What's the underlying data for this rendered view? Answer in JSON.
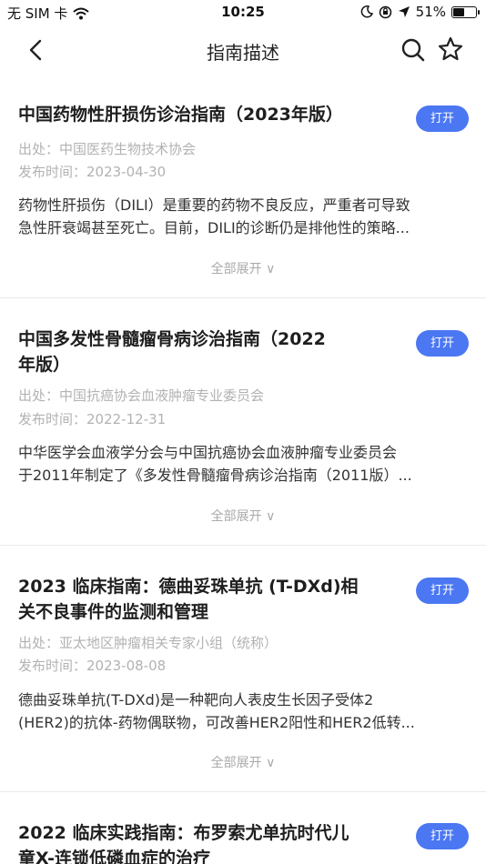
{
  "status_bar": {
    "carrier": "无 SIM 卡",
    "time": "10:25",
    "battery_percent": "51%",
    "battery_level": 0.51
  },
  "nav": {
    "title": "指南描述",
    "back_icon": "chevron-left-icon",
    "search_icon": "search-icon",
    "favorite_icon": "star-icon"
  },
  "accent_color": "#4b77f2",
  "guides": [
    {
      "title_lines": [
        "中国药物性肝损伤诊治指南（2023年版）"
      ],
      "button_label": "打开",
      "source": "出处：中国医药生物技术协会",
      "publish_date": "发布时间：2023-04-30",
      "summary_lines": [
        "药物性肝损伤（DILI）是重要的药物不良反应，严重者可导致",
        "急性肝衰竭甚至死亡。目前，DILI的诊断仍是排他性的策略..."
      ],
      "expand_label": "全部展开 ∨"
    },
    {
      "title_lines": [
        "中国多发性骨髓瘤骨病诊治指南（2022",
        "年版）"
      ],
      "button_label": "打开",
      "source": "出处：中国抗癌协会血液肿瘤专业委员会",
      "publish_date": "发布时间：2022-12-31",
      "summary_lines": [
        "中华医学会血液学分会与中国抗癌协会血液肿瘤专业委员会",
        "于2011年制定了《多发性骨髓瘤骨病诊治指南（2011版）..."
      ],
      "expand_label": "全部展开 ∨"
    },
    {
      "title_lines": [
        "2023 临床指南：德曲妥珠单抗 (T-DXd)相",
        "关不良事件的监测和管理"
      ],
      "button_label": "打开",
      "source": "出处：亚太地区肿瘤相关专家小组（统称）",
      "publish_date": "发布时间：2023-08-08",
      "summary_lines": [
        "德曲妥珠单抗(T-DXd)是一种靶向人表皮生长因子受体2",
        "(HER2)的抗体-药物偶联物，可改善HER2阳性和HER2低转..."
      ],
      "expand_label": "全部展开 ∨"
    },
    {
      "title_lines": [
        "2022 临床实践指南：布罗索尤单抗时代儿",
        "童X-连锁低磷血症的治疗"
      ],
      "button_label": "打开"
    }
  ]
}
